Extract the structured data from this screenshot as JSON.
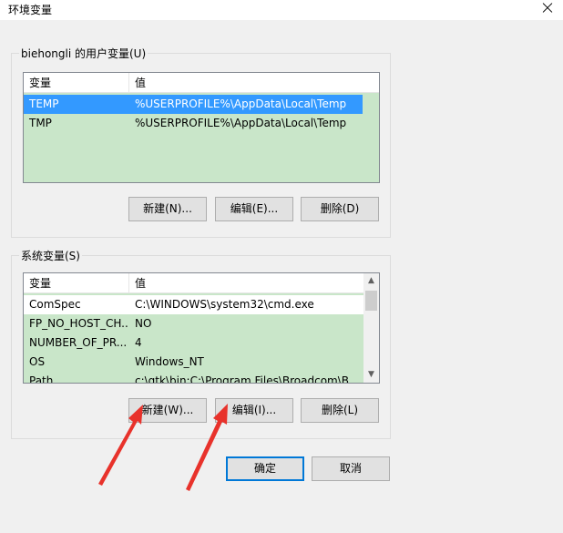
{
  "window": {
    "title": "环境变量",
    "close_icon": "close-icon"
  },
  "user_vars": {
    "group_label": "biehongli 的用户变量(U)",
    "columns": [
      "变量",
      "值"
    ],
    "rows": [
      {
        "name": "TEMP",
        "value": "%USERPROFILE%\\AppData\\Local\\Temp",
        "selected": true
      },
      {
        "name": "TMP",
        "value": "%USERPROFILE%\\AppData\\Local\\Temp",
        "selected": false
      }
    ],
    "new_label": "新建(N)...",
    "edit_label": "编辑(E)...",
    "delete_label": "删除(D)"
  },
  "system_vars": {
    "group_label": "系统变量(S)",
    "columns": [
      "变量",
      "值"
    ],
    "rows": [
      {
        "name": "ComSpec",
        "value": "C:\\WINDOWS\\system32\\cmd.exe"
      },
      {
        "name": "FP_NO_HOST_CH...",
        "value": "NO"
      },
      {
        "name": "NUMBER_OF_PR...",
        "value": "4"
      },
      {
        "name": "OS",
        "value": "Windows_NT"
      },
      {
        "name": "Path",
        "value": "c:\\gtk\\bin;C:\\Program Files\\Broadcom\\B..."
      }
    ],
    "new_label": "新建(W)...",
    "edit_label": "编辑(I)...",
    "delete_label": "删除(L)"
  },
  "footer": {
    "ok_label": "确定",
    "cancel_label": "取消"
  },
  "colors": {
    "list_background": "#c9e6c9",
    "selection": "#3399ff",
    "annotation_arrow": "#e8322b"
  }
}
